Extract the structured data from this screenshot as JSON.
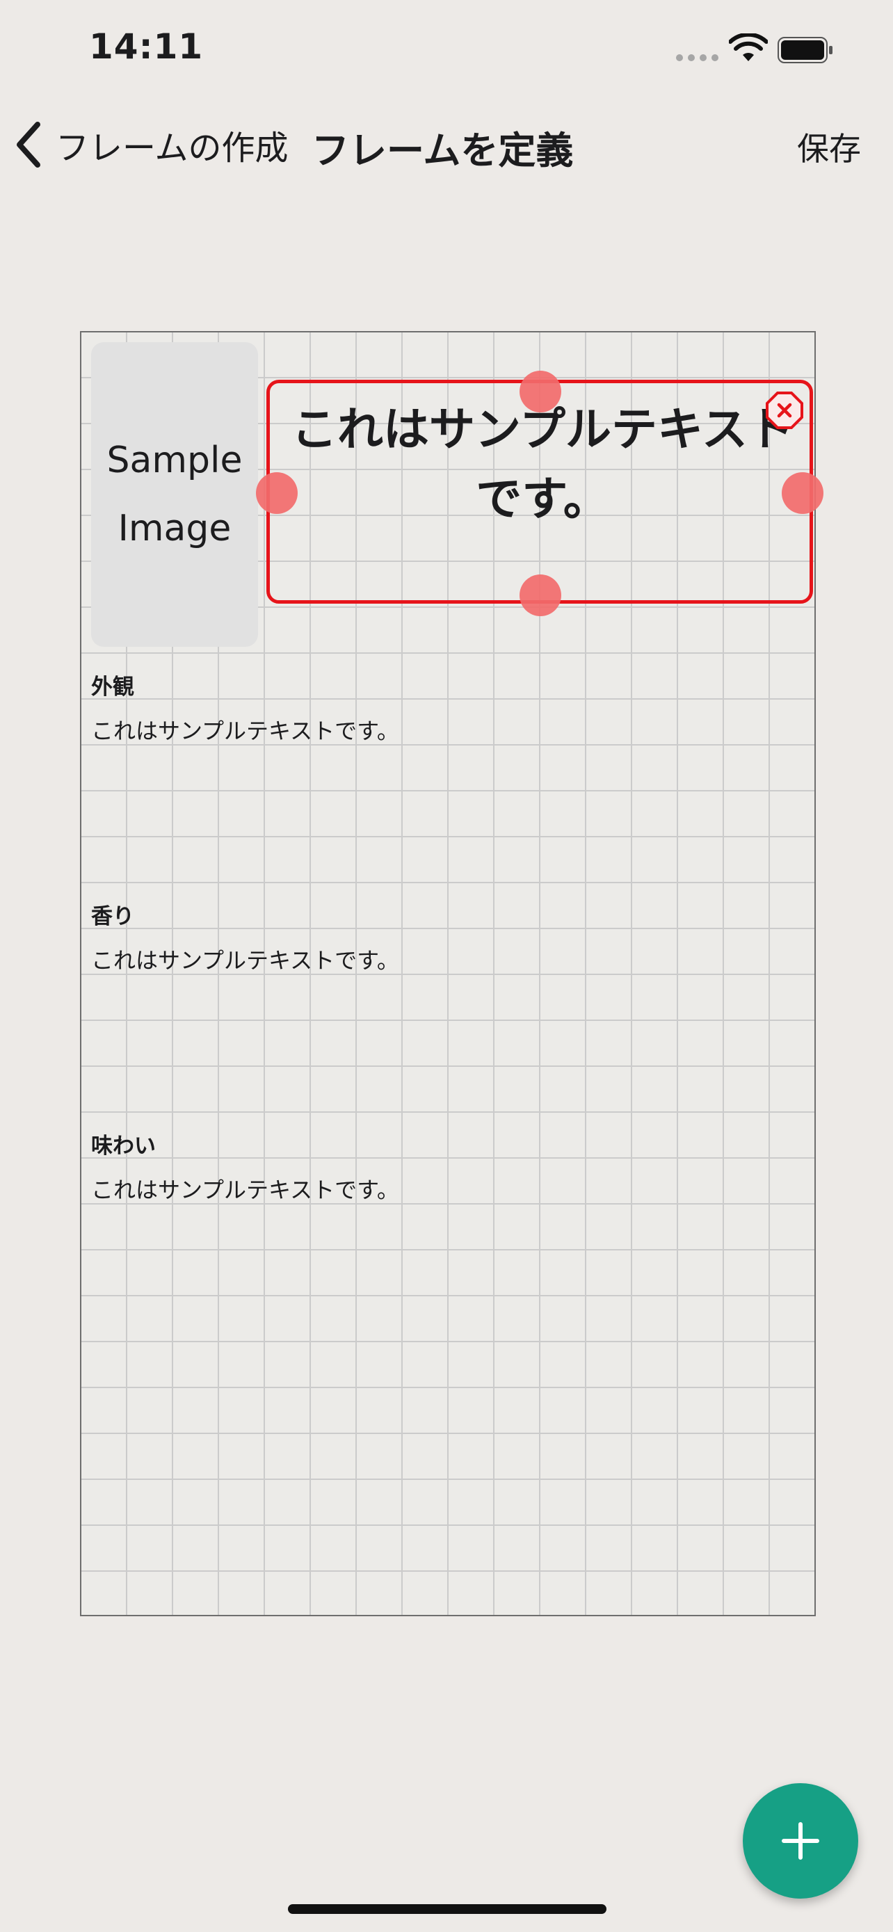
{
  "status_bar": {
    "time": "14:11"
  },
  "nav": {
    "back_label": "フレームの作成",
    "title": "フレームを定義",
    "save_label": "保存"
  },
  "canvas": {
    "sample_image_label": "Sample\nImage",
    "selected_text": "これはサンプルテキストです。",
    "sections": [
      {
        "heading": "外観",
        "body": "これはサンプルテキストです。"
      },
      {
        "heading": "香り",
        "body": "これはサンプルテキストです。"
      },
      {
        "heading": "味わい",
        "body": "これはサンプルテキストです。"
      }
    ]
  },
  "colors": {
    "selection": "#e6141a",
    "handle": "#f26b6b",
    "fab": "#16a085",
    "background": "#edeae7"
  },
  "icons": {
    "back": "chevron-left-icon",
    "delete": "close-octagon-icon",
    "add": "plus-icon"
  }
}
